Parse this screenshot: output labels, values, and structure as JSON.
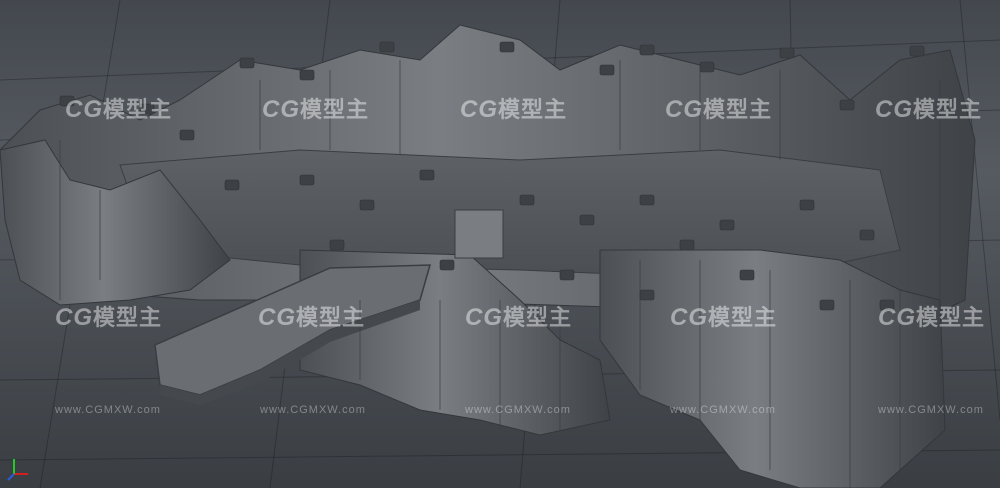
{
  "viewport": {
    "watermark_logo": "CG",
    "watermark_text": "模型主",
    "watermark_url": "www.CGMXW.com",
    "colors": {
      "background_top": "#43484e",
      "background_mid": "#565b61",
      "background_bottom": "#3a3e43",
      "rock": "#6f7378",
      "rock_dark": "#3e4246",
      "rock_light": "#8d9196"
    },
    "axis_gizmo": {
      "icon": "xyz-axis-icon",
      "x_color": "#d22020",
      "y_color": "#27c927",
      "z_color": "#2b5bd8"
    }
  }
}
